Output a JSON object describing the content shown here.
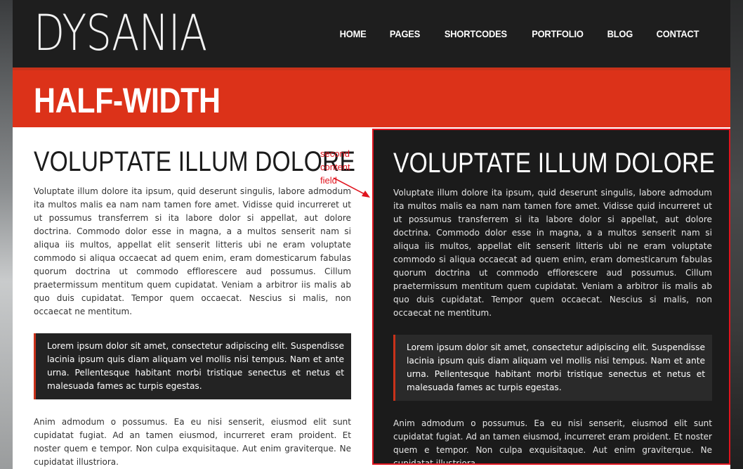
{
  "header": {
    "logo": "DYSANIA",
    "nav": [
      "HOME",
      "PAGES",
      "SHORTCODES",
      "PORTFOLIO",
      "BLOG",
      "CONTACT"
    ]
  },
  "banner": {
    "title": "HALF-WIDTH"
  },
  "left": {
    "heading": "VOLUPTATE ILLUM DOLORE",
    "body": "Voluptate illum dolore ita ipsum, quid deserunt singulis, labore admodum ita multos malis ea nam nam tamen fore amet. Vidisse quid incurreret ut ut possumus transferrem si ita labore dolor si appellat, aut dolore doctrina. Commodo dolor esse in magna, a a multos senserit nam si aliqua iis multos, appellat elit senserit litteris ubi ne eram voluptate commodo si aliqua occaecat ad quem enim, eram domesticarum fabulas quorum doctrina ut commodo efflorescere aud possumus. Cillum praetermissum mentitum quem cupidatat. Veniam a arbitror iis malis ab quo duis cupidatat. Tempor quem occaecat. Nescius si malis, non occaecat ne mentitum.",
    "quote": "Lorem ipsum dolor sit amet, consectetur adipiscing elit. Suspendisse lacinia ipsum quis diam aliquam vel mollis nisi tempus. Nam et ante urna. Pellentesque habitant morbi tristique senectus et netus et malesuada fames ac turpis egestas.",
    "body2": "Anim admodum o possumus. Ea eu nisi senserit, eiusmod elit sunt cupidatat fugiat. Ad an tamen eiusmod, incurreret eram proident. Et noster quem e tempor. Non culpa exquisitaque. Aut enim graviterque. Ne cupidatat illustriora."
  },
  "right": {
    "heading": "VOLUPTATE ILLUM DOLORE",
    "body": "Voluptate illum dolore ita ipsum, quid deserunt singulis, labore admodum ita multos malis ea nam nam tamen fore amet. Vidisse quid incurreret ut ut possumus transferrem si ita labore dolor si appellat, aut dolore doctrina. Commodo dolor esse in magna, a a multos senserit nam si aliqua iis multos, appellat elit senserit litteris ubi ne eram voluptate commodo si aliqua occaecat ad quem enim, eram domesticarum fabulas quorum doctrina ut commodo efflorescere aud possumus. Cillum praetermissum mentitum quem cupidatat. Veniam a arbitror iis malis ab quo duis cupidatat. Tempor quem occaecat. Nescius si malis, non occaecat ne mentitum.",
    "quote": "Lorem ipsum dolor sit amet, consectetur adipiscing elit. Suspendisse lacinia ipsum quis diam aliquam vel mollis nisi tempus. Nam et ante urna. Pellentesque habitant morbi tristique senectus et netus et malesuada fames ac turpis egestas.",
    "body2": "Anim admodum o possumus. Ea eu nisi senserit, eiusmod elit sunt cupidatat fugiat. Ad an tamen eiusmod, incurreret eram proident. Et noster quem e tempor. Non culpa exquisitaque. Aut enim graviterque. Ne cupidatat illustriora."
  },
  "annotation": {
    "lines": [
      "second",
      "content",
      "field"
    ]
  },
  "colors": {
    "accent": "#dc3219",
    "header_bg": "#1e1e1e",
    "annotation": "#e0141e"
  }
}
